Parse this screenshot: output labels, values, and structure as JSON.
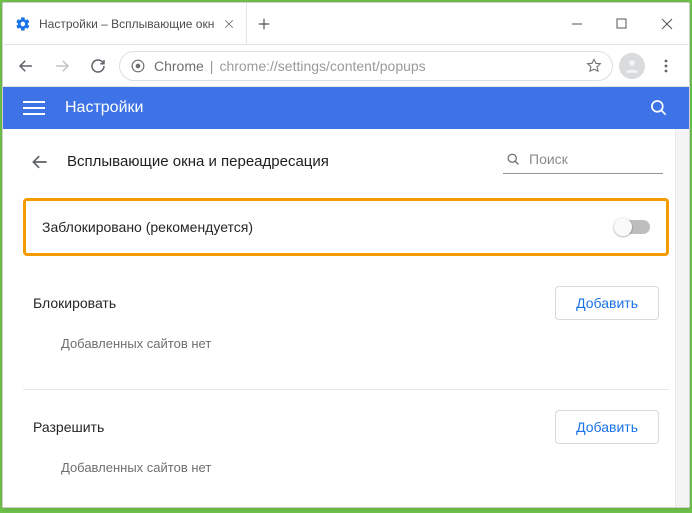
{
  "window": {
    "tab_title": "Настройки – Всплывающие окн"
  },
  "omnibox": {
    "host": "Chrome",
    "path": "chrome://settings/content/popups"
  },
  "appbar": {
    "title": "Настройки"
  },
  "page": {
    "title": "Всплывающие окна и переадресация",
    "search_placeholder": "Поиск",
    "blocked_row_label": "Заблокировано (рекомендуется)",
    "blocked_toggle_on": false,
    "block_section": {
      "label": "Блокировать",
      "add_label": "Добавить",
      "empty_text": "Добавленных сайтов нет"
    },
    "allow_section": {
      "label": "Разрешить",
      "add_label": "Добавить",
      "empty_text": "Добавленных сайтов нет"
    }
  },
  "colors": {
    "accent": "#3d73e6",
    "highlight_border": "#f49b00"
  }
}
